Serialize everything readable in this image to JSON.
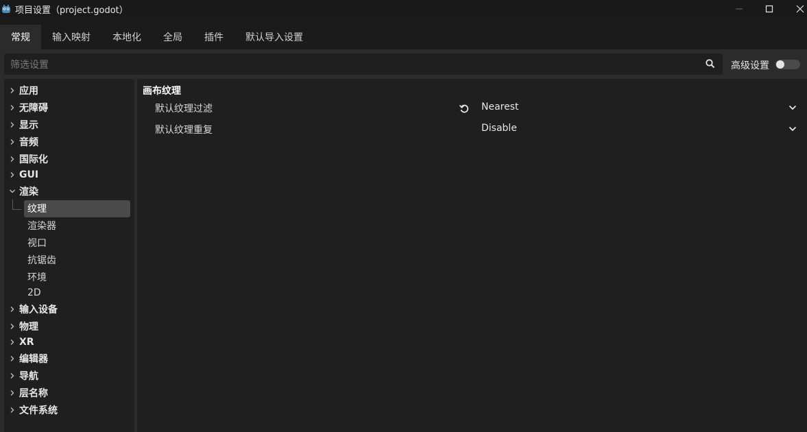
{
  "window": {
    "title": "项目设置（project.godot）"
  },
  "tabs": [
    {
      "label": "常规",
      "active": true
    },
    {
      "label": "输入映射",
      "active": false
    },
    {
      "label": "本地化",
      "active": false
    },
    {
      "label": "全局",
      "active": false
    },
    {
      "label": "插件",
      "active": false
    },
    {
      "label": "默认导入设置",
      "active": false
    }
  ],
  "search": {
    "placeholder": "筛选设置"
  },
  "advanced": {
    "label": "高级设置",
    "enabled": false
  },
  "tree": {
    "items": [
      {
        "label": "应用"
      },
      {
        "label": "无障碍"
      },
      {
        "label": "显示"
      },
      {
        "label": "音频"
      },
      {
        "label": "国际化"
      },
      {
        "label": "GUI"
      },
      {
        "label": "渲染"
      },
      {
        "label": "纹理"
      },
      {
        "label": "渲染器"
      },
      {
        "label": "视口"
      },
      {
        "label": "抗锯齿"
      },
      {
        "label": "环境"
      },
      {
        "label": "2D"
      },
      {
        "label": "输入设备"
      },
      {
        "label": "物理"
      },
      {
        "label": "XR"
      },
      {
        "label": "编辑器"
      },
      {
        "label": "导航"
      },
      {
        "label": "层名称"
      },
      {
        "label": "文件系统"
      }
    ]
  },
  "inspector": {
    "section_title": "画布纹理",
    "properties": [
      {
        "label": "默认纹理过滤",
        "value": "Nearest"
      },
      {
        "label": "默认纹理重复",
        "value": "Disable"
      }
    ]
  },
  "colors": {
    "background": "#1b1b1b",
    "panel": "#2b2b2b",
    "field": "#1f1f1f",
    "selection": "#4a4a4a"
  },
  "icons": [
    "godot-logo-icon",
    "minimize-icon",
    "maximize-icon",
    "close-icon",
    "search-icon",
    "chevron-right-icon",
    "chevron-down-icon",
    "revert-icon",
    "dropdown-arrow-icon"
  ]
}
